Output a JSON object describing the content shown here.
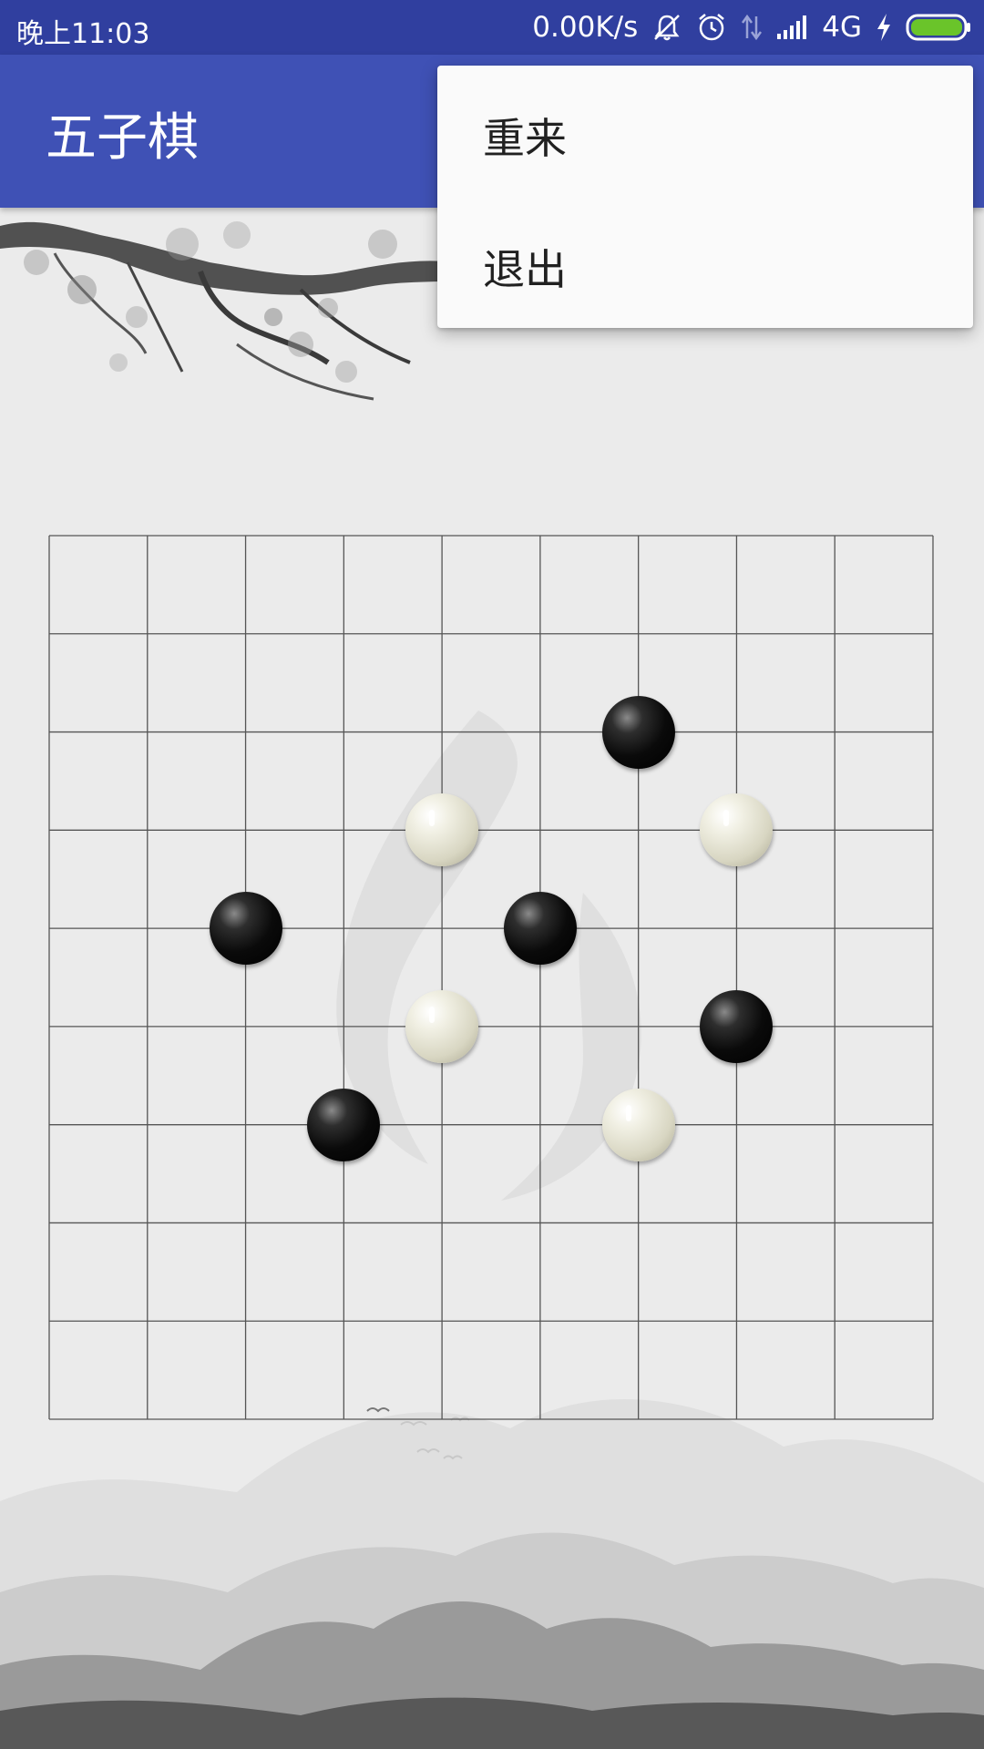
{
  "status_bar": {
    "time": "晚上11:03",
    "speed": "0.00K/s",
    "network": "4G",
    "icons": [
      "mute-icon",
      "alarm-icon",
      "data-transfer-icon",
      "signal-icon",
      "charging-icon",
      "battery-icon"
    ],
    "battery_color": "#6ac42a"
  },
  "app_bar": {
    "title": "五子棋",
    "color": "#3f51b5"
  },
  "overflow_menu": {
    "items": [
      {
        "label": "重来"
      },
      {
        "label": "退出"
      }
    ]
  },
  "board": {
    "grid_size": 9,
    "line_color": "#555555",
    "stones": [
      {
        "color": "black",
        "col": 6,
        "row": 2
      },
      {
        "color": "white",
        "col": 4,
        "row": 3
      },
      {
        "color": "white",
        "col": 7,
        "row": 3
      },
      {
        "color": "black",
        "col": 2,
        "row": 4
      },
      {
        "color": "black",
        "col": 5,
        "row": 4
      },
      {
        "color": "white",
        "col": 4,
        "row": 5
      },
      {
        "color": "black",
        "col": 7,
        "row": 5
      },
      {
        "color": "black",
        "col": 3,
        "row": 6
      },
      {
        "color": "white",
        "col": 6,
        "row": 6
      }
    ]
  }
}
